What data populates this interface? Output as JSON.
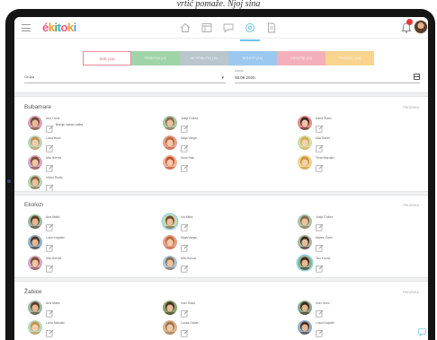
{
  "caption": "vrtić pomaže. Njoj sina",
  "app": {
    "logo_letters": [
      "é",
      "k",
      "i",
      "t",
      "o",
      "k",
      "i"
    ],
    "logo_colors": [
      "#f05a7e",
      "#f59b32",
      "#3fae49",
      "#3aa3d9",
      "#f05a7e",
      "#f59b32",
      "#3aa3d9"
    ]
  },
  "nav": {
    "icons": [
      "home-icon",
      "grid-icon",
      "chat-icon",
      "settings-icon",
      "document-icon"
    ],
    "active_index": 3
  },
  "header": {
    "notifications_count": ""
  },
  "tabs": [
    {
      "label": "sve (10)",
      "color": "#ffffff",
      "active": true
    },
    {
      "label": "prisutni (10)",
      "color": "#9fd4a8",
      "active": false
    },
    {
      "label": "ne prisutni (10)",
      "color": "#b9c6cc",
      "active": false
    },
    {
      "label": "bolest (10)",
      "color": "#9cc8ef",
      "active": false
    },
    {
      "label": "odsutni (10)",
      "color": "#f4b0ba",
      "active": false
    },
    {
      "label": "praznici (10)",
      "color": "#f8d48f",
      "active": false
    }
  ],
  "filters": {
    "group_label": "Grupa",
    "date_caption": "Datum",
    "date_value": "08.09.2020."
  },
  "groups": [
    {
      "title": "Bubamare",
      "action": "Prozivka",
      "children": [
        {
          "name": "Ana Horić",
          "note": "Boruje nakon ručka",
          "skin": "#e9b996",
          "hair": "#6b4a32",
          "bg": "#d9a0b6",
          "ring": false
        },
        {
          "name": "Josip Čolina",
          "note": "",
          "skin": "#eac2a0",
          "hair": "#8a6b4b",
          "bg": "#a9c6a5",
          "ring": false
        },
        {
          "name": "Karla Šukić",
          "note": "",
          "skin": "#f0c4a5",
          "hair": "#3a2a22",
          "bg": "#e88b8b",
          "ring": false
        },
        {
          "name": "Lana Horić",
          "note": "",
          "skin": "#f1cfae",
          "hair": "#c4924a",
          "bg": "#b9d4c0",
          "ring": false
        },
        {
          "name": "Maja Varga",
          "note": "",
          "skin": "#f3c9a8",
          "hair": "#b56a3b",
          "bg": "#e6a08c",
          "ring": false
        },
        {
          "name": "Mia Daher",
          "note": "",
          "skin": "#f3d3b0",
          "hair": "#d7a85a",
          "bg": "#cfe0a6",
          "ring": false
        },
        {
          "name": "Mia Horvat",
          "note": "",
          "skin": "#eec6a2",
          "hair": "#7a4f32",
          "bg": "#d6a6c6",
          "ring": false
        },
        {
          "name": "Nora Hak",
          "note": "",
          "skin": "#f2c8a8",
          "hair": "#c1502f",
          "bg": "#f0b49a",
          "ring": false
        },
        {
          "name": "Tena Marušić",
          "note": "",
          "skin": "#f2d0ae",
          "hair": "#c99548",
          "bg": "#f3d38a",
          "ring": false
        },
        {
          "name": "Viktor Rudić",
          "note": "",
          "skin": "#eac0a0",
          "hair": "#8a6444",
          "bg": "#b7d1b3",
          "ring": false
        }
      ]
    },
    {
      "title": "Ekolozi",
      "action": "Prozivka",
      "children": [
        {
          "name": "Ana Matić",
          "note": "",
          "skin": "#e3b595",
          "hair": "#5a3c28",
          "bg": "#9ab9a3",
          "ring": false
        },
        {
          "name": "Ivo Mikić",
          "note": "",
          "skin": "#e9c09e",
          "hair": "#6f4e34",
          "bg": "#c9d7a7",
          "ring": true
        },
        {
          "name": "Josip Čolina",
          "note": "",
          "skin": "#eac2a0",
          "hair": "#8a6b4b",
          "bg": "#a9c6a5",
          "ring": false
        },
        {
          "name": "Luka Krajačić",
          "note": "",
          "skin": "#e3b896",
          "hair": "#4f3424",
          "bg": "#8fb0c8",
          "ring": false
        },
        {
          "name": "Maja Varga",
          "note": "",
          "skin": "#f3c9a8",
          "hair": "#b56a3b",
          "bg": "#e6a08c",
          "ring": false
        },
        {
          "name": "Mateo Ćurić",
          "note": "",
          "skin": "#e7bc9a",
          "hair": "#3d2a1e",
          "bg": "#a7b7a2",
          "ring": false
        },
        {
          "name": "Mia Horvat",
          "note": "",
          "skin": "#eec6a2",
          "hair": "#7a4f32",
          "bg": "#d6a6c6",
          "ring": false
        },
        {
          "name": "Mia Horvat",
          "note": "",
          "skin": "#ecc4a2",
          "hair": "#8b6a4c",
          "bg": "#a8c4d8",
          "ring": false
        },
        {
          "name": "Teo Kovač",
          "note": "",
          "skin": "#e6b894",
          "hair": "#3f2c20",
          "bg": "#8fb08a",
          "ring": true
        }
      ]
    },
    {
      "title": "Žabice",
      "action": "Prozivka",
      "children": [
        {
          "name": "Ana Matić",
          "note": "",
          "skin": "#e3b595",
          "hair": "#5a3c28",
          "bg": "#9ab9a3",
          "ring": false
        },
        {
          "name": "Ivan Šukić",
          "note": "",
          "skin": "#e7bd9a",
          "hair": "#4a3322",
          "bg": "#88a56a",
          "ring": false
        },
        {
          "name": "Ivan Horić",
          "note": "",
          "skin": "#e2b391",
          "hair": "#3a281c",
          "bg": "#8aa88f",
          "ring": false
        },
        {
          "name": "Lana Marušić",
          "note": "",
          "skin": "#f1cfae",
          "hair": "#c4924a",
          "bg": "#b9d4c0",
          "ring": false
        },
        {
          "name": "Lucas Daher",
          "note": "",
          "skin": "#eec7a4",
          "hair": "#9b7350",
          "bg": "#d8b58d",
          "ring": false
        },
        {
          "name": "Luka Krajačić",
          "note": "",
          "skin": "#e3b896",
          "hair": "#4f3424",
          "bg": "#8fb0c8",
          "ring": false
        }
      ]
    }
  ]
}
